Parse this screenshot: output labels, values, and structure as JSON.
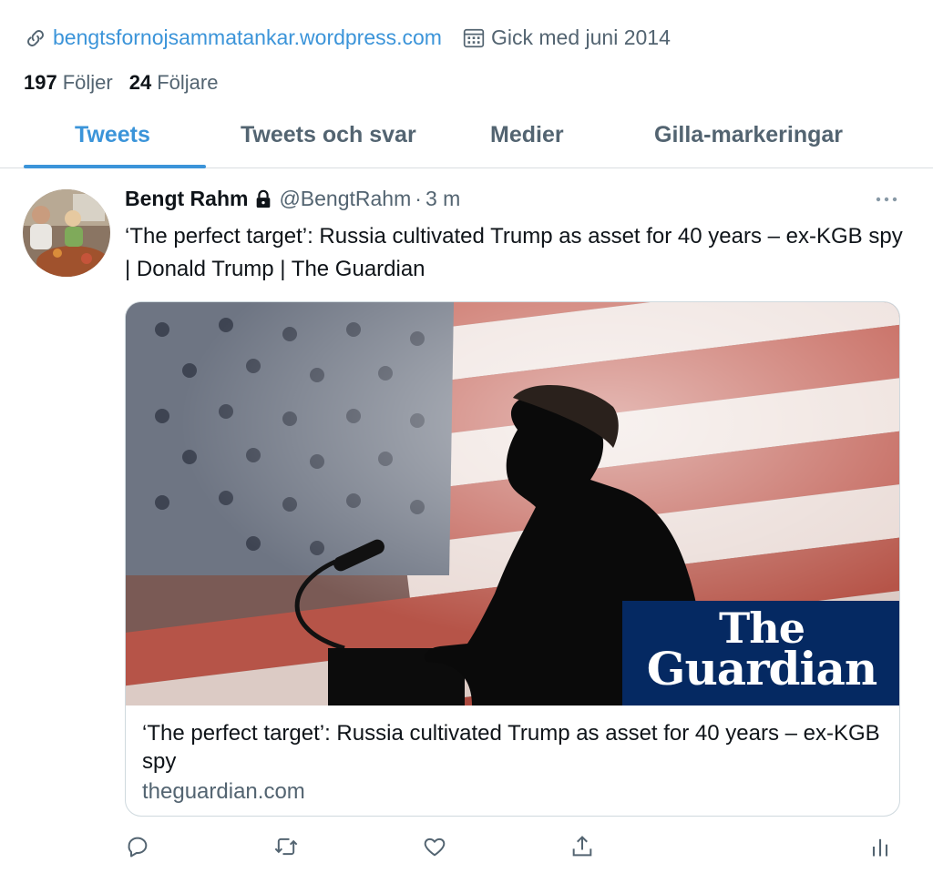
{
  "profile": {
    "website": "bengtsfornojsammatankar.wordpress.com",
    "joined": "Gick med juni 2014",
    "following_count": "197",
    "following_label": "Följer",
    "followers_count": "24",
    "followers_label": "Följare"
  },
  "tabs": [
    {
      "label": "Tweets",
      "active": true
    },
    {
      "label": "Tweets och svar",
      "active": false
    },
    {
      "label": "Medier",
      "active": false
    },
    {
      "label": "Gilla-markeringar",
      "active": false
    }
  ],
  "tweet": {
    "author_name": "Bengt Rahm",
    "handle": "@BengtRahm",
    "separator": "·",
    "time": "3 m",
    "text": "‘The perfect target’: Russia cultivated Trump as asset for 40 years – ex-KGB spy | Donald Trump | The Guardian",
    "card": {
      "logo_line1": "The",
      "logo_line2": "Guardian",
      "title": "‘The perfect target’: Russia cultivated Trump as asset for 40 years – ex-KGB spy",
      "domain": "theguardian.com"
    }
  },
  "icons": {
    "link": "link-icon",
    "calendar": "calendar-icon",
    "lock": "lock-icon",
    "more": "more-icon",
    "reply": "reply-icon",
    "retweet": "retweet-icon",
    "like": "like-icon",
    "share": "share-icon",
    "analytics": "analytics-icon"
  },
  "colors": {
    "accent": "#3b94d9",
    "text": "#0f1419",
    "secondary": "#536471",
    "border": "#cfd9de",
    "guardian_blue": "#052962"
  }
}
